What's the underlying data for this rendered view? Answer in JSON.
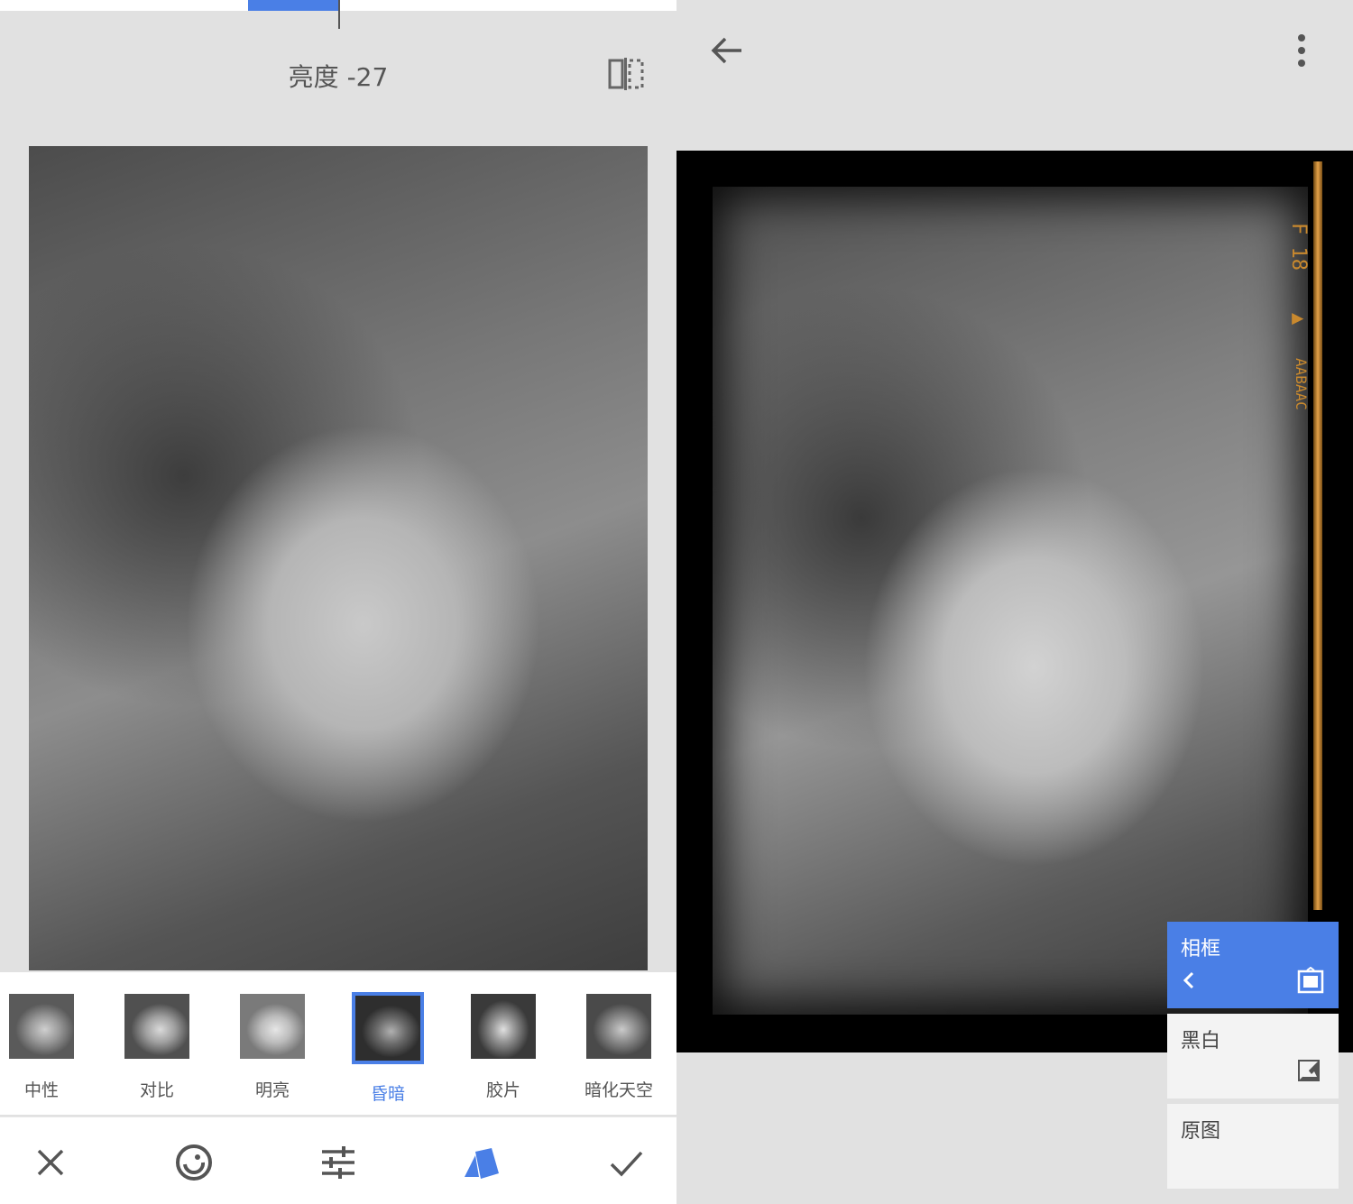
{
  "left": {
    "adjust_label": "亮度 -27",
    "filters": [
      {
        "label": "中性",
        "selected": false
      },
      {
        "label": "对比",
        "selected": false
      },
      {
        "label": "明亮",
        "selected": false
      },
      {
        "label": "昏暗",
        "selected": true
      },
      {
        "label": "胶片",
        "selected": false
      },
      {
        "label": "暗化天空",
        "selected": false
      }
    ],
    "toolbar_icons": [
      "close-icon",
      "grain-dial-icon",
      "sliders-icon",
      "styles-icon",
      "check-icon"
    ]
  },
  "right": {
    "film_marks": [
      "F 18",
      "▲",
      "AABAAC"
    ],
    "menu": {
      "header": "相框",
      "items": [
        "黑白",
        "原图"
      ]
    }
  },
  "colors": {
    "accent": "#4a7fe6",
    "background": "#e1e1e1",
    "film_orange": "#e5a24a"
  }
}
